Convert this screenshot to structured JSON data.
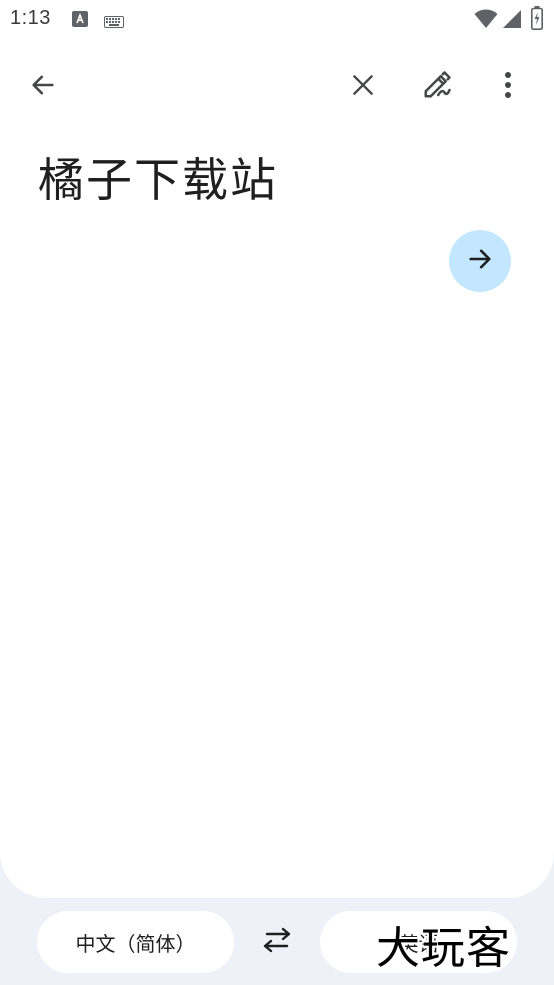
{
  "status_bar": {
    "time": "1:13",
    "icons": [
      "a-badge-icon",
      "keyboard-icon",
      "wifi-icon",
      "signal-icon",
      "battery-charging-icon"
    ]
  },
  "toolbar": {
    "back": "arrow-back-icon",
    "clear": "close-icon",
    "handwriting": "handwriting-icon",
    "more": "more-vertical-icon"
  },
  "input": {
    "text": "橘子下载站"
  },
  "translate_button": {
    "icon": "arrow-forward-icon",
    "color": "#c2e7ff"
  },
  "languages": {
    "source": "中文（简体）",
    "target": "英语",
    "swap_icon": "swap-arrows-icon"
  },
  "watermark": {
    "text": "大玩客"
  },
  "colors": {
    "background": "#eef1f8",
    "card": "#ffffff",
    "accent": "#c2e7ff",
    "icon": "#444746"
  }
}
